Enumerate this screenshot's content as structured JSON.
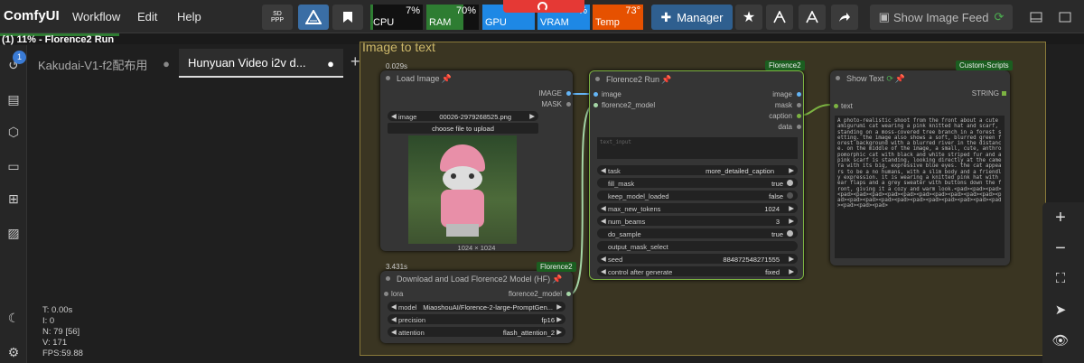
{
  "app": {
    "name": "ComfyUI",
    "menu": [
      "Workflow",
      "Edit",
      "Help"
    ]
  },
  "toolbar": {
    "sd_label": "SD\nPPP",
    "manager_label": "Manager",
    "show_feed_label": "Show Image Feed"
  },
  "meters": {
    "cpu": {
      "label": "CPU",
      "pct": "7%",
      "level": 0.07,
      "color": "#2e7d32"
    },
    "ram": {
      "label": "RAM",
      "pct": "70%",
      "level": 0.7,
      "color": "#2e7d32"
    },
    "gpu": {
      "label": "GPU",
      "pct": "",
      "level": 1.0,
      "color": "#1e88e5"
    },
    "vram": {
      "label": "VRAM",
      "pct": "%",
      "level": 1.0,
      "color": "#1e88e5"
    },
    "temp": {
      "label": "Temp",
      "pct": "73°",
      "level": 1.0,
      "color": "#e65100"
    }
  },
  "progress": {
    "text": "(1) 11% - Florence2 Run",
    "level": 0.11
  },
  "queue_badge": "1",
  "tabs": [
    {
      "label": "Kakudai-V1-f2配布用",
      "active": false
    },
    {
      "label": "Hunyuan Video i2v d...",
      "active": true
    }
  ],
  "group_title": "Image to text",
  "stats": {
    "t": "T: 0.00s",
    "i": "I: 0",
    "n": "N: 79 [56]",
    "v": "V: 171",
    "fps": "FPS:59.88"
  },
  "load_image": {
    "time": "0.029s",
    "title": "Load Image",
    "outputs": [
      "IMAGE",
      "MASK"
    ],
    "image_label": "image",
    "image_value": "00026-2979268525.png",
    "upload_label": "choose file to upload",
    "dims": "1024 × 1024"
  },
  "download": {
    "time": "3.431s",
    "badge": "Florence2",
    "title": "Download and Load Florence2 Model (HF)",
    "input": "lora",
    "output": "florence2_model",
    "widgets": [
      {
        "label": "model",
        "value": "MiaoshouAI/Florence-2-large-PromptGen..."
      },
      {
        "label": "precision",
        "value": "fp16"
      },
      {
        "label": "attention",
        "value": "flash_attention_2"
      }
    ]
  },
  "florence_run": {
    "badge": "Florence2",
    "title": "Florence2 Run",
    "inputs": [
      "image",
      "florence2_model"
    ],
    "outputs": [
      "image",
      "mask",
      "caption",
      "data"
    ],
    "text_placeholder": "text_input",
    "widgets": [
      {
        "label": "task",
        "value": "more_detailed_caption"
      },
      {
        "label": "fill_mask",
        "value": "true"
      },
      {
        "label": "keep_model_loaded",
        "value": "false"
      },
      {
        "label": "max_new_tokens",
        "value": "1024"
      },
      {
        "label": "num_beams",
        "value": "3"
      },
      {
        "label": "do_sample",
        "value": "true"
      },
      {
        "label": "output_mask_select",
        "value": ""
      },
      {
        "label": "seed",
        "value": "884872548271555"
      },
      {
        "label": "control after generate",
        "value": "fixed"
      }
    ]
  },
  "show_text": {
    "badge": "Custom-Scripts",
    "title": "Show Text",
    "input": "text",
    "output": "STRING",
    "content": "A photo-realistic shoot from the front about a cute amigurumi cat wearing a pink knitted hat and scarf, standing on a moss-covered tree branch in a forest setting. the image also shows a soft, blurred green forest background with a blurred river in the distance. on the middle of the image, a small, cute, anthropomorphic cat with black and white striped fur and a pink scarf is standing, looking directly at the camera with its big, expressive blue eyes. the cat appears to be a no humans, with a slim body and a friendly expression. it is wearing a knitted pink hat with ear flaps and a grey sweater with buttons down the front, giving it a cozy and warm look.<pad><pad><pad><pad><pad><pad><pad><pad><pad><pad><pad><pad><pad><pad><pad><pad><pad><pad><pad><pad><pad><pad><pad><pad><pad><pad><pad>"
  }
}
